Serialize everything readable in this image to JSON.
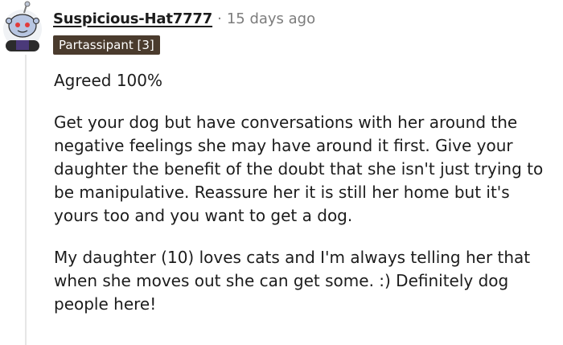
{
  "comment": {
    "username": "Suspicious-Hat7777",
    "separator": "·",
    "posted_age": "15 days ago",
    "flair": "Partassipant [3]",
    "paragraphs": [
      "Agreed 100%",
      "Get your dog but have conversations with her around the negative feelings she may have around it first. Give your daughter the benefit of the doubt that she isn't just trying to be manipulative. Reassure her it is still her home but it's yours too and you want to get a dog.",
      "My daughter (10) loves cats and I'm always telling her that when she moves out she can get some. :) Definitely dog people here!"
    ]
  },
  "colors": {
    "flair_bg": "#4a3b2d",
    "meta_text": "#7c7c7c",
    "body_text": "#1c1c1c",
    "thread_line": "#e6e6e6"
  },
  "icons": {
    "avatar": "snoo-avatar-icon"
  }
}
